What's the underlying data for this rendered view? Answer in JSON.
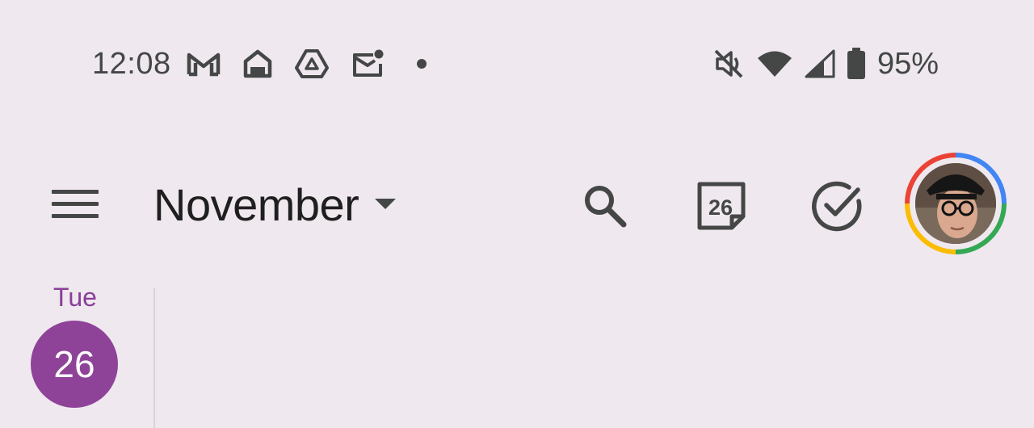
{
  "status_bar": {
    "time": "12:08",
    "left_icons": [
      "gmail-icon",
      "home-icon",
      "drive-icon",
      "mail-notification-icon",
      "more-notifications-dot"
    ],
    "right_icons": [
      "mute-icon",
      "wifi-icon",
      "cell-signal-icon",
      "battery-icon"
    ],
    "battery_percent": "95%"
  },
  "app_bar": {
    "menu_icon": "hamburger-menu-icon",
    "month_title": "November",
    "month_dropdown_icon": "caret-down-icon",
    "search_icon": "search-icon",
    "today_label": "26",
    "tasks_icon": "check-circle-icon",
    "avatar": "account-avatar"
  },
  "day": {
    "weekday": "Tue",
    "date": "26"
  },
  "colors": {
    "background": "#efe8ef",
    "today_accent": "#8e4398",
    "weekday_text": "#8a3f98",
    "icon_gray": "#444746",
    "ring_red": "#ea4335",
    "ring_blue": "#4285f4",
    "ring_green": "#34a853",
    "ring_yellow": "#fbbc05"
  }
}
